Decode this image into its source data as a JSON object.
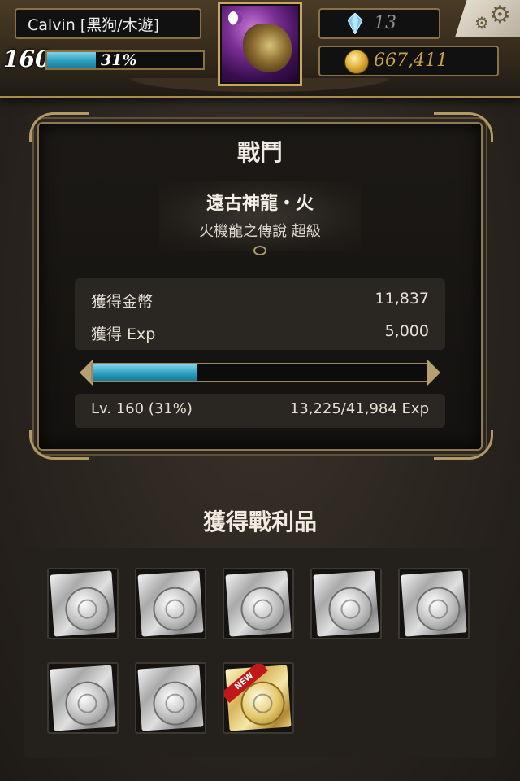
{
  "hud": {
    "player_name": "Calvin [黑狗/木遊]",
    "level": "160",
    "exp_percent_label": "31%",
    "exp_fraction": 0.31,
    "gems": "13",
    "coins": "667,411",
    "icons": {
      "settings": "gear-icon",
      "gem": "diamond-icon",
      "coin": "coin-icon"
    }
  },
  "battle": {
    "title": "戰鬥",
    "stage_name": "遠古神龍・火",
    "stage_subtitle": "火機龍之傳說 超級",
    "coins_label": "獲得金幣",
    "coins_value": "11,837",
    "exp_label": "獲得 Exp",
    "exp_value": "5,000",
    "progress_fraction": 0.31,
    "level_text": "Lv. 160 (31%)",
    "exp_total_text": "13,225/41,984 Exp"
  },
  "loot": {
    "title": "獲得戰利品",
    "items": [
      {
        "kind": "silver-card"
      },
      {
        "kind": "silver-card"
      },
      {
        "kind": "silver-card"
      },
      {
        "kind": "silver-card"
      },
      {
        "kind": "silver-card"
      },
      {
        "kind": "silver-card"
      },
      {
        "kind": "silver-card"
      },
      {
        "kind": "gold-card",
        "badge": "NEW"
      }
    ]
  },
  "colors": {
    "accent_cyan": "#2aa0c0",
    "frame_gold": "#b19a66",
    "panel_bg": "#1c1916"
  }
}
